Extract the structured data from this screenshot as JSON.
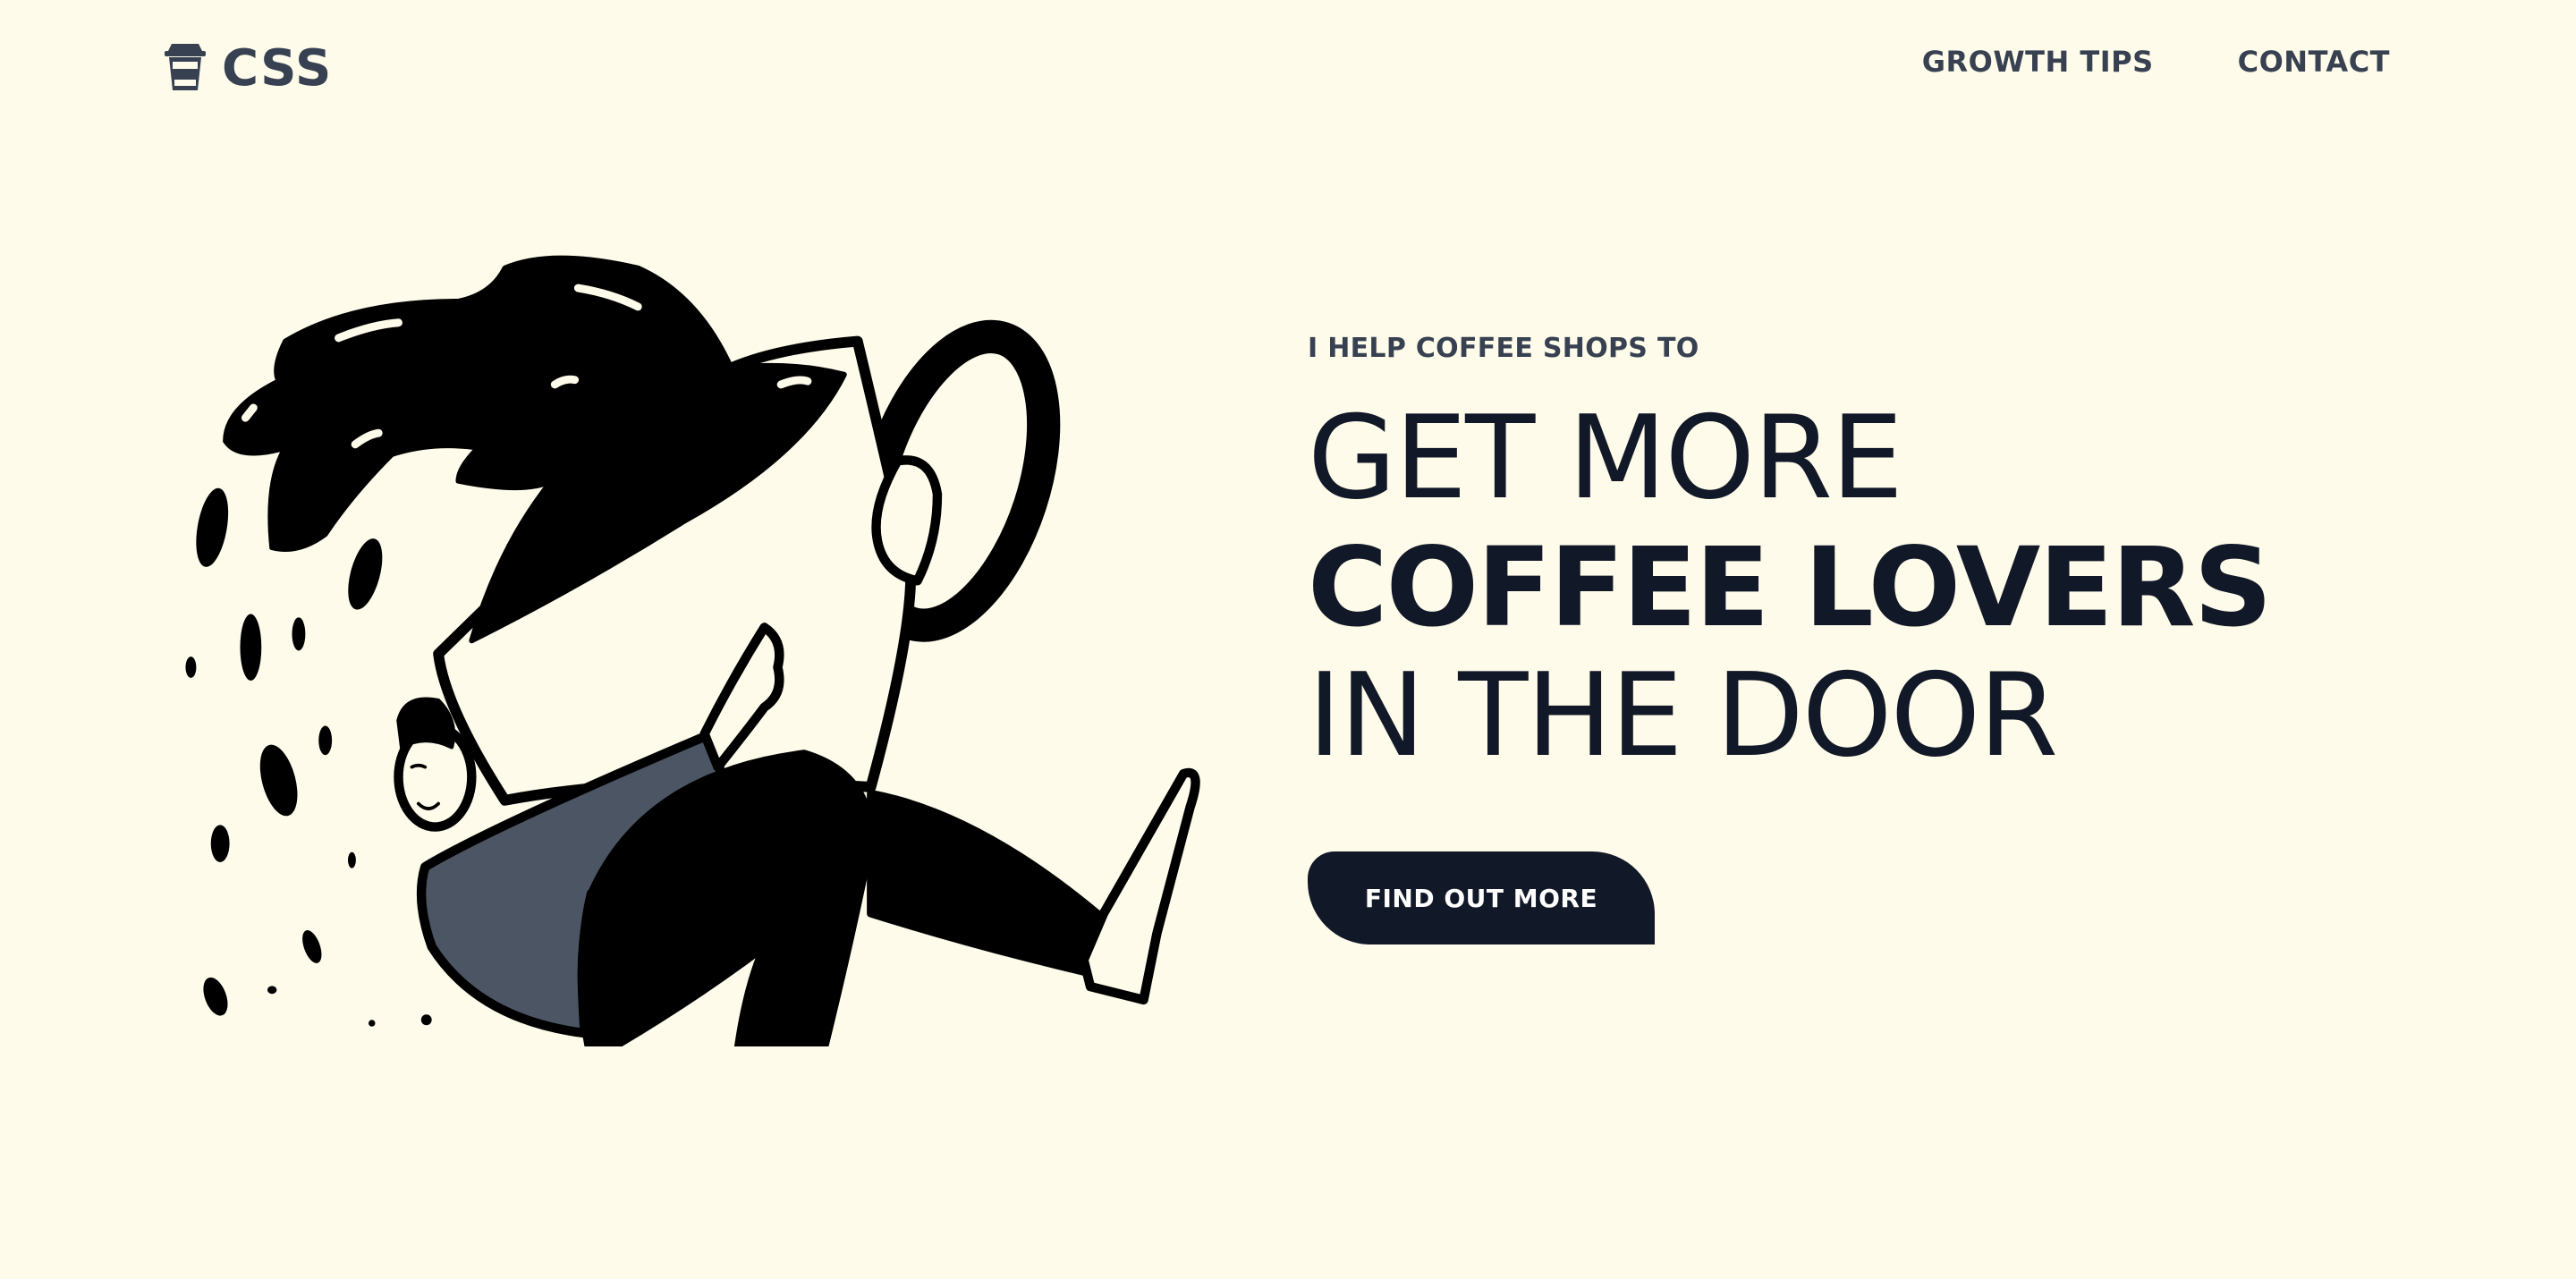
{
  "header": {
    "logo_text": "CSS",
    "logo_icon": "coffee-cup-icon",
    "nav": [
      {
        "label": "GROWTH TIPS"
      },
      {
        "label": "CONTACT"
      }
    ]
  },
  "hero": {
    "kicker": "I HELP COFFEE SHOPS TO",
    "headline_line1": "GET MORE",
    "headline_line2": "COFFEE LOVERS",
    "headline_line3": "IN THE DOOR",
    "cta_label": "FIND OUT MORE"
  },
  "colors": {
    "background": "#fefbea",
    "text_dark": "#111827",
    "text_muted": "#374151",
    "sweater": "#4b5563"
  }
}
